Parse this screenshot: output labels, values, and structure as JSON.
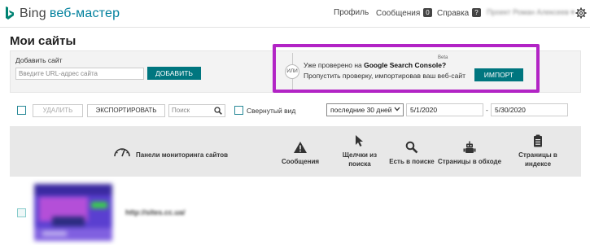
{
  "header": {
    "brand": "Bing",
    "product": "веб-мастер",
    "nav": [
      {
        "label": "Профиль"
      },
      {
        "label": "Сообщения",
        "badge": "0"
      },
      {
        "label": "Справка",
        "badge": "?"
      }
    ],
    "user": "Проект Роман Алексеев"
  },
  "page": {
    "title": "Мои сайты"
  },
  "add_site": {
    "label": "Добавить сайт",
    "placeholder": "Введите URL-адрес сайта",
    "button": "ДОБАВИТЬ"
  },
  "gsc_import": {
    "or": "ИЛИ",
    "beta": "Beta",
    "line1_prefix": "Уже проверено на ",
    "line1_bold": "Google Search Console?",
    "line2": "Пропустить проверку, импортировав ваш веб-сайт",
    "button": "ИМПОРТ"
  },
  "toolbar": {
    "delete": "УДАЛИТЬ",
    "export": "ЭКСПОРТИРОВАТЬ",
    "search_placeholder": "Поиск",
    "collapsed_view": "Свернутый вид",
    "period": "последние 30 дней",
    "date_from": "5/1/2020",
    "date_sep": "-",
    "date_to": "5/30/2020"
  },
  "table": {
    "columns": {
      "dashboard": "Панели мониторинга сайтов",
      "messages": "Сообщения",
      "clicks": [
        "Щелчки из",
        "поиска"
      ],
      "indexed_search": "Есть в поиске",
      "crawled": "Страницы в обходе",
      "indexed_pages": [
        "Страницы в",
        "индексе"
      ]
    },
    "rows": [
      {
        "url": "http://sites.cc.ua/"
      }
    ]
  },
  "colors": {
    "accent": "#00767f",
    "brand": "#00809d",
    "highlight": "#b224c5"
  }
}
